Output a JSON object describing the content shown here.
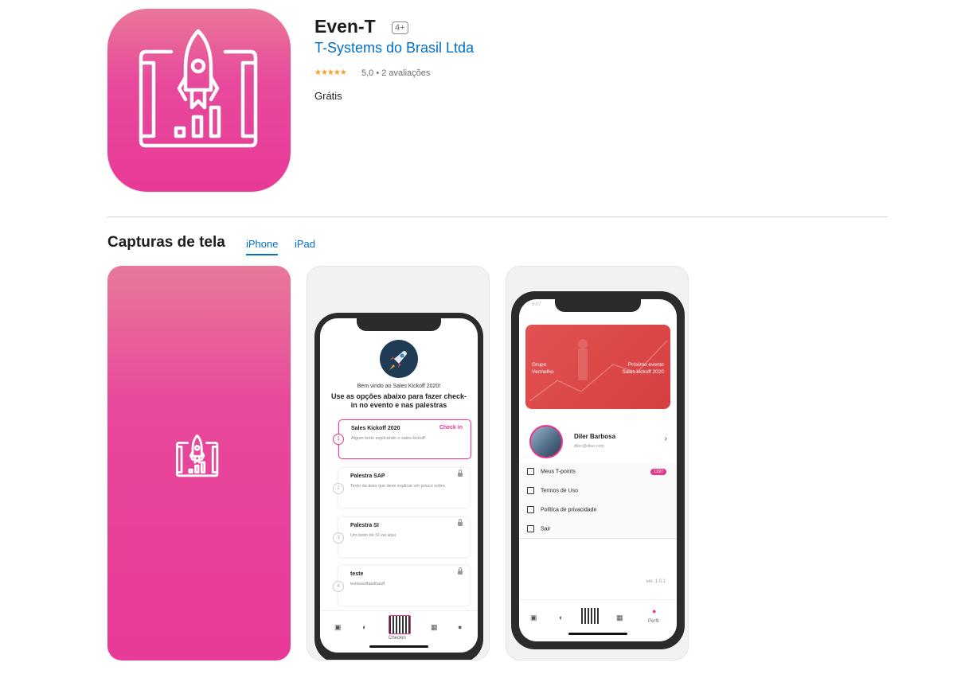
{
  "app": {
    "title": "Even-T",
    "age_rating": "4+",
    "developer": "T-Systems do Brasil Ltda",
    "stars": "★★★★★",
    "rating_text": "5,0 • 2 avaliações",
    "price": "Grátis",
    "icon": "rocket-chart-icon",
    "brand_color": "#e83a98"
  },
  "screenshots_section": {
    "title": "Capturas de tela",
    "tabs": [
      {
        "label": "iPhone",
        "selected": true
      },
      {
        "label": "iPad",
        "selected": false
      }
    ]
  },
  "screen2": {
    "welcome": "Bem vindo ao Sales Kickoff 2020!",
    "headline": "Use as opções abaixo para fazer check-in no evento e nas palestras",
    "cards": [
      {
        "step": "1",
        "title": "Sales Kickoff 2020",
        "desc": "Algum texto explicando o sales kickoff.",
        "action": "Check in"
      },
      {
        "step": "2",
        "title": "Palestra SAP",
        "desc": "Texto da área que deve explicar um pouco sobre."
      },
      {
        "step": "3",
        "title": "Palestra SI",
        "desc": "Um texto de SI vai aqui."
      },
      {
        "step": "4",
        "title": "teste",
        "desc": "testeasdfasdfasdf"
      }
    ],
    "tab_active_label": "Checkin"
  },
  "screen3": {
    "time": "8:57",
    "card_left": [
      "Grupo",
      "Vermelho"
    ],
    "card_right": [
      "Próximo evento",
      "Sales kickoff 2020"
    ],
    "name": "Diler Barbosa",
    "email": "diler@diler.com",
    "menu": [
      {
        "label": "Meus T-points",
        "badge": "1197"
      },
      {
        "label": "Termos de Uso"
      },
      {
        "label": "Política de privacidade"
      },
      {
        "label": "Sair"
      }
    ],
    "version": "ver. 1.0.1",
    "tab_active_label": "Perfil"
  }
}
